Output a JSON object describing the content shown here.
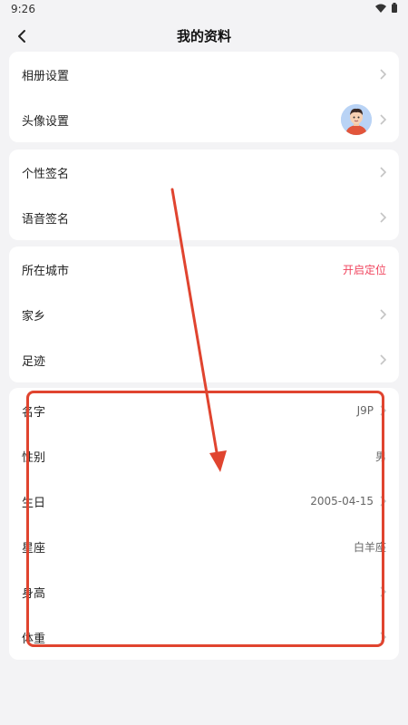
{
  "status_bar": {
    "time": "9:26"
  },
  "header": {
    "title": "我的资料"
  },
  "sections": {
    "album": {
      "label": "相册设置"
    },
    "avatar": {
      "label": "头像设置"
    },
    "signature": {
      "label": "个性签名"
    },
    "voice_signature": {
      "label": "语音签名"
    },
    "city": {
      "label": "所在城市",
      "value": "开启定位"
    },
    "hometown": {
      "label": "家乡"
    },
    "footprint": {
      "label": "足迹"
    },
    "name": {
      "label": "名字",
      "value": "J9P"
    },
    "gender": {
      "label": "性别",
      "value": "男"
    },
    "birthday": {
      "label": "生日",
      "value": "2005-04-15"
    },
    "zodiac": {
      "label": "星座",
      "value": "白羊座"
    },
    "height": {
      "label": "身高"
    },
    "weight": {
      "label": "体重"
    }
  },
  "colors": {
    "accent": "#f0445e",
    "annotation": "#e0442f",
    "background": "#f3f3f5"
  },
  "icons": [
    "back-arrow-icon",
    "chevron-right-icon",
    "wifi-icon",
    "battery-icon"
  ]
}
